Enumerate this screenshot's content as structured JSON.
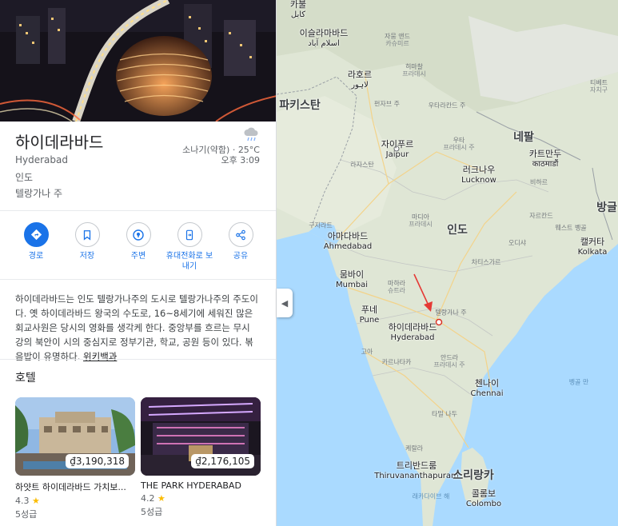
{
  "place": {
    "title": "하이데라바드",
    "subtitle": "Hyderabad",
    "country": "인도",
    "region": "텔랑가나 주"
  },
  "weather": {
    "icon": "rain-cloud-icon",
    "condition_temp": "소나기(약함) · 25°C",
    "time": "오후 3:09"
  },
  "actions": [
    {
      "label": "경로",
      "icon": "directions-icon",
      "primary": true
    },
    {
      "label": "저장",
      "icon": "bookmark-icon"
    },
    {
      "label": "주변",
      "icon": "nearby-icon"
    },
    {
      "label": "휴대전화로 보내기",
      "icon": "send-to-phone-icon"
    },
    {
      "label": "공유",
      "icon": "share-icon"
    }
  ],
  "description": {
    "text": "하이데라바드는 인도 텔랑가나주의 도시로 텔랑가나주의 주도이다. 옛 하이데라바드 왕국의 수도로, 16~8세기에 세워진 많은 회교사원은 당시의 영화를 생각케 한다. 중앙부를 흐르는 무시 강의 북안이 시의 중심지로 정부기관, 학교, 공원 등이 있다. 볶음밥이 유명하다.",
    "link": "위키백과"
  },
  "hotels": {
    "title": "호텔",
    "items": [
      {
        "name": "하얏트 하이데라바드 가치보...",
        "price": "₫3,190,318",
        "rating": "4.3",
        "stars": "5성급"
      },
      {
        "name": "THE PARK HYDERABAD",
        "price": "₫2,176,105",
        "rating": "4.2",
        "stars": "5성급"
      }
    ]
  },
  "map": {
    "colors": {
      "land": "#dfe6d5",
      "water": "#aadaff",
      "border": "#9aa0a6",
      "marker_arrow": "#e53935"
    },
    "labels": [
      {
        "id": "kabul",
        "type": "city",
        "ko": "카불",
        "lo": "کابل"
      },
      {
        "id": "islamabad",
        "type": "city",
        "ko": "이슬라마바드",
        "lo": "اسلام آباد"
      },
      {
        "id": "jammu",
        "type": "state",
        "ko": "자뭄 앤드",
        "lo": "카슈미르"
      },
      {
        "id": "himachal",
        "type": "state",
        "ko": "히마찰",
        "lo": "프라데시"
      },
      {
        "id": "lahore",
        "type": "city",
        "ko": "라호르",
        "lo": "لاہور"
      },
      {
        "id": "pakistan",
        "type": "country",
        "ko": "파키스탄",
        "lo": ""
      },
      {
        "id": "punjab",
        "type": "state",
        "ko": "펀자브 주",
        "lo": ""
      },
      {
        "id": "uttarakhand",
        "type": "state",
        "ko": "우타라칸드 주",
        "lo": ""
      },
      {
        "id": "tibet",
        "type": "state",
        "ko": "티베트",
        "lo": "자치구"
      },
      {
        "id": "jaipur",
        "type": "city",
        "ko": "자이푸르",
        "lo": "Jaipur"
      },
      {
        "id": "rajasthan",
        "type": "state",
        "ko": "라자스탄",
        "lo": ""
      },
      {
        "id": "nepal",
        "type": "country",
        "ko": "네팔",
        "lo": ""
      },
      {
        "id": "kathmandu",
        "type": "city",
        "ko": "카트만두",
        "lo": "काठमाडौं"
      },
      {
        "id": "uttarpradesh",
        "type": "state",
        "ko": "우타",
        "lo": "프라데시 주"
      },
      {
        "id": "lucknow",
        "type": "city",
        "ko": "러크나우",
        "lo": "Lucknow"
      },
      {
        "id": "bihar",
        "type": "state",
        "ko": "비하르",
        "lo": ""
      },
      {
        "id": "bangladesh",
        "type": "country",
        "ko": "방글",
        "lo": ""
      },
      {
        "id": "jharkhand",
        "type": "state",
        "ko": "자르칸드",
        "lo": ""
      },
      {
        "id": "westbengal",
        "type": "state",
        "ko": "웨스트 벵골",
        "lo": ""
      },
      {
        "id": "madhya",
        "type": "state",
        "ko": "마디아",
        "lo": "프라데시"
      },
      {
        "id": "gujarat",
        "type": "state",
        "ko": "구자라트",
        "lo": ""
      },
      {
        "id": "india",
        "type": "country",
        "ko": "인도",
        "lo": ""
      },
      {
        "id": "ahmedabad",
        "type": "city",
        "ko": "아마다바드",
        "lo": "Ahmedabad"
      },
      {
        "id": "kolkata",
        "type": "city",
        "ko": "캘커타",
        "lo": "Kolkata"
      },
      {
        "id": "odisha",
        "type": "state",
        "ko": "오디샤",
        "lo": ""
      },
      {
        "id": "chhattisgarh",
        "type": "state",
        "ko": "차티스가르",
        "lo": ""
      },
      {
        "id": "mumbai",
        "type": "city",
        "ko": "뭄바이",
        "lo": "Mumbai"
      },
      {
        "id": "maharashtra",
        "type": "state",
        "ko": "마하라",
        "lo": "슈트라"
      },
      {
        "id": "telangana",
        "type": "state",
        "ko": "텔랑가나 주",
        "lo": ""
      },
      {
        "id": "pune",
        "type": "city",
        "ko": "푸네",
        "lo": "Pune"
      },
      {
        "id": "hyderabad",
        "type": "city",
        "ko": "하이데라바드",
        "lo": "Hyderabad"
      },
      {
        "id": "goa",
        "type": "state",
        "ko": "고아",
        "lo": ""
      },
      {
        "id": "andhra",
        "type": "state",
        "ko": "안드라",
        "lo": "프라데시 주"
      },
      {
        "id": "karnataka",
        "type": "state",
        "ko": "카르나타카",
        "lo": ""
      },
      {
        "id": "chennai",
        "type": "city",
        "ko": "첸나이",
        "lo": "Chennai"
      },
      {
        "id": "bay",
        "type": "water",
        "ko": "벵골 만",
        "lo": ""
      },
      {
        "id": "tamilnadu",
        "type": "state",
        "ko": "타밀 나두",
        "lo": ""
      },
      {
        "id": "kerala",
        "type": "state",
        "ko": "케랄라",
        "lo": ""
      },
      {
        "id": "thiruvananthapuram",
        "type": "city",
        "ko": "트리반드룸",
        "lo": "Thiruvananthapuram"
      },
      {
        "id": "srilanka",
        "type": "country",
        "ko": "스리랑카",
        "lo": ""
      },
      {
        "id": "colombo",
        "type": "city",
        "ko": "콜롬보",
        "lo": "Colombo"
      },
      {
        "id": "laccadive",
        "type": "water",
        "ko": "래카다이브 해",
        "lo": ""
      }
    ]
  }
}
